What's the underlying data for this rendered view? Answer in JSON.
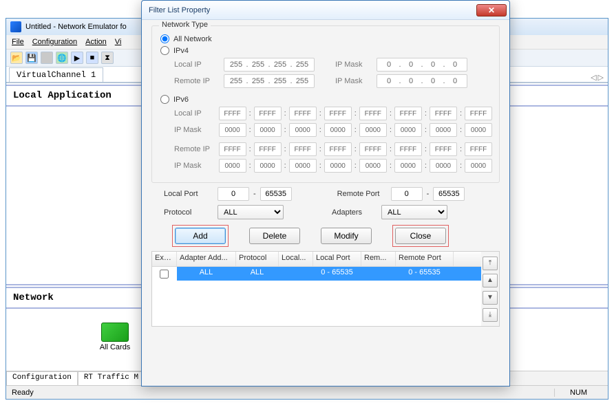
{
  "main": {
    "title": "Untitled - Network Emulator fo",
    "menus": {
      "file": "File",
      "configuration": "Configuration",
      "action": "Action",
      "view": "Vi"
    },
    "tab": "VirtualChannel 1",
    "sections": {
      "local_app": "Local Application",
      "network": "Network"
    },
    "all_cards": "All Cards",
    "bottom_tabs": {
      "config": "Configuration",
      "rt": "RT Traffic M"
    },
    "status": {
      "ready": "Ready",
      "num": "NUM"
    }
  },
  "dialog": {
    "title": "Filter List Property",
    "network_type": "Network Type",
    "all_network": "All Network",
    "ipv4": {
      "label": "IPv4",
      "local_ip": "Local IP",
      "remote_ip": "Remote IP",
      "ip_mask": "IP Mask",
      "octet": "255",
      "mask_octet": "0"
    },
    "ipv6": {
      "label": "IPv6",
      "local_ip": "Local IP",
      "remote_ip": "Remote IP",
      "ip_mask": "IP Mask",
      "hex": "FFFF",
      "mask_hex": "0000"
    },
    "ports": {
      "local": "Local Port",
      "remote": "Remote Port",
      "min": "0",
      "max": "65535"
    },
    "protocol": {
      "label": "Protocol",
      "value": "ALL"
    },
    "adapters": {
      "label": "Adapters",
      "value": "ALL"
    },
    "buttons": {
      "add": "Add",
      "delete": "Delete",
      "modify": "Modify",
      "close": "Close"
    },
    "table": {
      "headers": {
        "excl": "Excl...",
        "adapter": "Adapter Add...",
        "protocol": "Protocol",
        "local": "Local...",
        "local_port": "Local Port",
        "rem": "Rem...",
        "remote_port": "Remote Port"
      },
      "row": {
        "adapter": "ALL",
        "protocol": "ALL",
        "local": "",
        "local_port": "0 - 65535",
        "rem": "",
        "remote_port": "0 - 65535"
      }
    }
  }
}
